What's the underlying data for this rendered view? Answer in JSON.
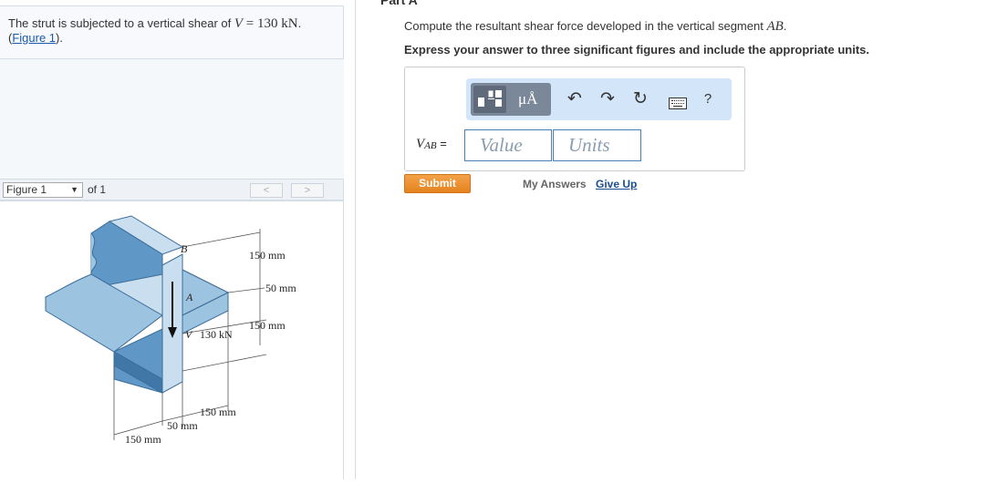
{
  "problem": {
    "text_before": "The strut is subjected to a vertical shear of ",
    "var": "V",
    "eq": " = 130 ",
    "unit": "kN",
    "text_after": ".",
    "figure_link": "Figure 1",
    "link_after": "."
  },
  "figure_bar": {
    "select_value": "Figure 1",
    "of_text": "of 1",
    "prev": "<",
    "next": ">"
  },
  "figure": {
    "label_B": "B",
    "label_A": "A",
    "label_V": "V",
    "shear_value": "130 kN",
    "dim_top": "150 mm",
    "dim_mid": "50 mm",
    "dim_right": "150 mm",
    "dim_bottom_right": "150 mm",
    "dim_bottom_mid": "50 mm",
    "dim_bottom_left": "150 mm"
  },
  "part": {
    "title": "Part A",
    "question_before": "Compute the resultant shear force developed in the vertical segment ",
    "question_sym": "AB",
    "question_after": ".",
    "instruction": "Express your answer to three significant figures and include the appropriate units."
  },
  "toolbar": {
    "units_symbol": "μÅ",
    "help": "?"
  },
  "answer": {
    "var": "V",
    "sub": "AB",
    "equals": " =",
    "value_placeholder": "Value",
    "units_placeholder": "Units"
  },
  "actions": {
    "submit": "Submit",
    "my_answers": "My Answers",
    "give_up": "Give Up"
  },
  "colors": {
    "toolbar_bg": "#d3e6f9",
    "submit": "#e5831e",
    "link": "#1a5aa8",
    "strut_light": "#c9dff0",
    "strut_mid": "#9cc3e0",
    "strut_dark": "#5f97c6"
  }
}
